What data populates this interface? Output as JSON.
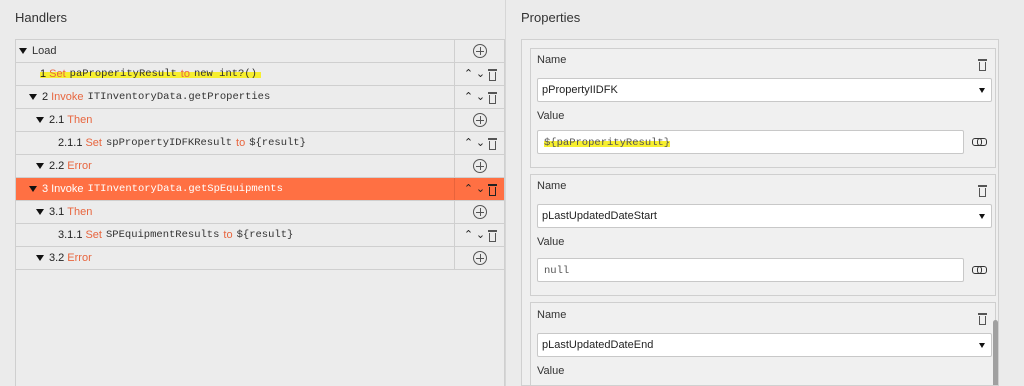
{
  "handlers": {
    "title": "Handlers",
    "rows": [
      {
        "num": "",
        "kw": "",
        "target": "",
        "label": "Load"
      },
      {
        "num": "1",
        "kw": "Set",
        "target": "paProperityResult",
        "to": "to",
        "value": "new int?()"
      },
      {
        "num": "2",
        "kw": "Invoke",
        "target": "ITInventoryData.getProperties"
      },
      {
        "num": "2.1",
        "kw": "Then"
      },
      {
        "num": "2.1.1",
        "kw": "Set",
        "target": "spPropertyIDFKResult",
        "to": "to",
        "value": "${result}"
      },
      {
        "num": "2.2",
        "kw": "Error"
      },
      {
        "num": "3",
        "kw": "Invoke",
        "target": "ITInventoryData.getSpEquipments"
      },
      {
        "num": "3.1",
        "kw": "Then"
      },
      {
        "num": "3.1.1",
        "kw": "Set",
        "target": "SPEquipmentResults",
        "to": "to",
        "value": "${result}"
      },
      {
        "num": "3.2",
        "kw": "Error"
      }
    ]
  },
  "properties": {
    "title": "Properties",
    "name_label": "Name",
    "value_label": "Value",
    "items": [
      {
        "name": "pPropertyIIDFK",
        "value": "${paProperityResult}"
      },
      {
        "name": "pLastUpdatedDateStart",
        "value": "null"
      },
      {
        "name": "pLastUpdatedDateEnd",
        "value": ""
      }
    ]
  },
  "colors": {
    "selected_row": "#ff7043",
    "keyword": "#e8663f",
    "highlight": "#f7ef2f"
  }
}
